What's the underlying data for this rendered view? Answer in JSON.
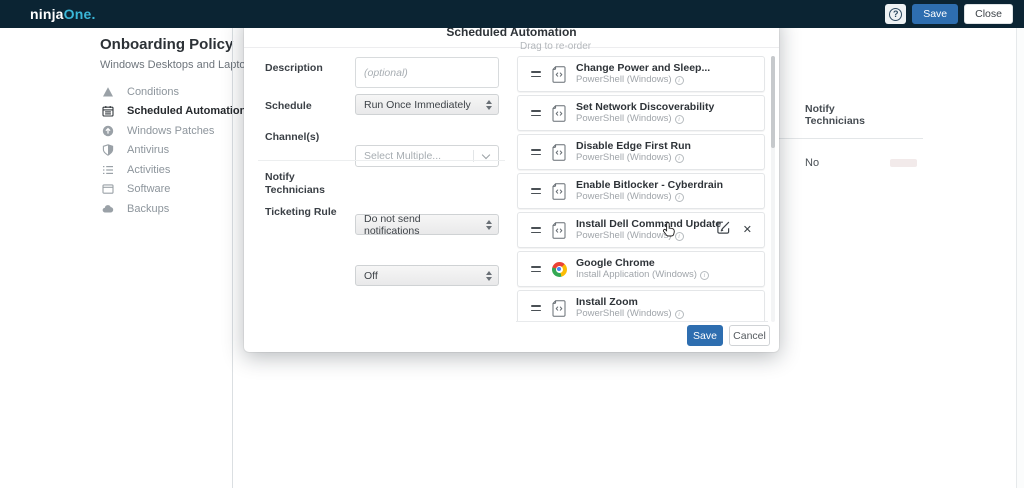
{
  "topbar": {
    "logo_ninja": "ninja",
    "logo_one": "One.",
    "help_label": "?",
    "save_label": "Save",
    "close_label": "Close"
  },
  "sidebar": {
    "title": "Onboarding Policy",
    "subtitle": "Windows Desktops and Laptops",
    "items": [
      {
        "icon": "warning-triangle-icon",
        "label": "Conditions",
        "active": false
      },
      {
        "icon": "calendar-icon",
        "label": "Scheduled Automations",
        "active": true
      },
      {
        "icon": "arrow-up-circle-icon",
        "label": "Windows Patches",
        "active": false
      },
      {
        "icon": "shield-icon",
        "label": "Antivirus",
        "active": false
      },
      {
        "icon": "list-icon",
        "label": "Activities",
        "active": false
      },
      {
        "icon": "window-icon",
        "label": "Software",
        "active": false
      },
      {
        "icon": "cloud-icon",
        "label": "Backups",
        "active": false
      }
    ]
  },
  "background_panel": {
    "column_header": "Notify Technicians",
    "value": "No"
  },
  "modal": {
    "title": "Scheduled Automation",
    "form": {
      "description_label": "Description",
      "description_placeholder": "(optional)",
      "schedule_label": "Schedule",
      "schedule_value": "Run Once Immediately",
      "channels_label": "Channel(s)",
      "channels_placeholder": "Select Multiple...",
      "notify_label": "Notify Technicians",
      "notify_value": "Do not send notifications",
      "ticketing_label": "Ticketing Rule",
      "ticketing_value": "Off"
    },
    "list": {
      "drag_hint": "Drag to re-order",
      "items": [
        {
          "icon": "script-icon",
          "title": "Change Power and Sleep...",
          "subtitle": "PowerShell (Windows)",
          "hover": false
        },
        {
          "icon": "script-icon",
          "title": "Set Network Discoverability",
          "subtitle": "PowerShell (Windows)",
          "hover": false
        },
        {
          "icon": "script-icon",
          "title": "Disable Edge First Run",
          "subtitle": "PowerShell (Windows)",
          "hover": false
        },
        {
          "icon": "script-icon",
          "title": "Enable Bitlocker - Cyberdrain",
          "subtitle": "PowerShell (Windows)",
          "hover": false
        },
        {
          "icon": "script-icon",
          "title": "Install Dell Command Update",
          "subtitle": "PowerShell (Windows)",
          "hover": true
        },
        {
          "icon": "chrome-icon",
          "title": "Google Chrome",
          "subtitle": "Install Application (Windows)",
          "hover": false
        },
        {
          "icon": "script-icon",
          "title": "Install Zoom",
          "subtitle": "PowerShell (Windows)",
          "hover": false
        }
      ]
    },
    "footer": {
      "save_label": "Save",
      "cancel_label": "Cancel"
    }
  },
  "colors": {
    "topbar_bg": "#0b2433",
    "logo_accent": "#3ab7d8",
    "primary_button": "#2e6eb0",
    "chrome_red": "#ea4335",
    "chrome_yellow": "#fbbc05",
    "chrome_green": "#34a853",
    "chrome_blue": "#4285f4"
  }
}
